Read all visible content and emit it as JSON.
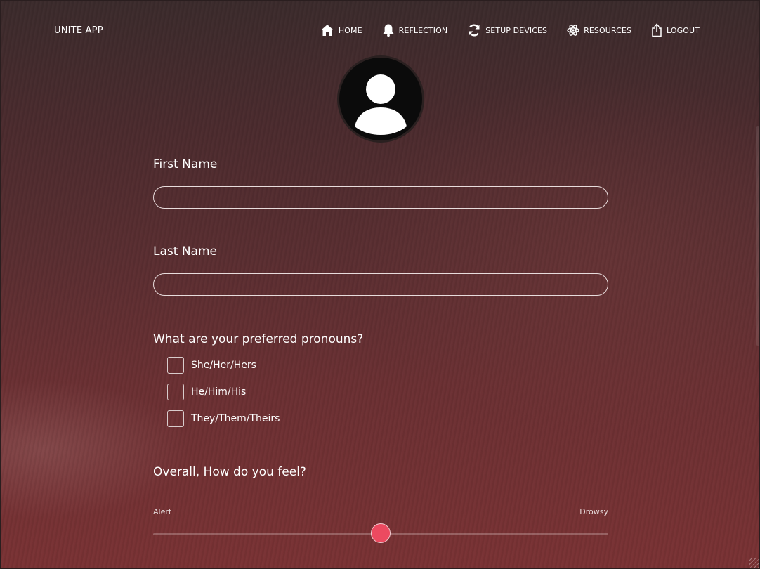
{
  "app": {
    "brand": "UNITE APP"
  },
  "nav": {
    "items": [
      {
        "label": "HOME",
        "icon": "home-icon"
      },
      {
        "label": "REFLECTION",
        "icon": "bell-icon"
      },
      {
        "label": "SETUP DEVICES",
        "icon": "sync-icon"
      },
      {
        "label": "RESOURCES",
        "icon": "atom-icon"
      },
      {
        "label": "LOGOUT",
        "icon": "share-logout-icon"
      }
    ]
  },
  "profile": {
    "avatar_icon": "user-avatar-icon"
  },
  "form": {
    "first_name": {
      "label": "First Name",
      "value": ""
    },
    "last_name": {
      "label": "Last Name",
      "value": ""
    },
    "pronouns": {
      "question": "What are your preferred pronouns?",
      "options": [
        {
          "label": "She/Her/Hers",
          "checked": false
        },
        {
          "label": "He/Him/His",
          "checked": false
        },
        {
          "label": "They/Them/Theirs",
          "checked": false
        }
      ]
    },
    "feeling": {
      "question": "Overall, How do you feel?",
      "min_label": "Alert",
      "max_label": "Drowsy",
      "value_fraction": 0.5
    }
  },
  "theme": {
    "slider_thumb_color": "#ec4a60",
    "background_tint": "#6b3033"
  }
}
